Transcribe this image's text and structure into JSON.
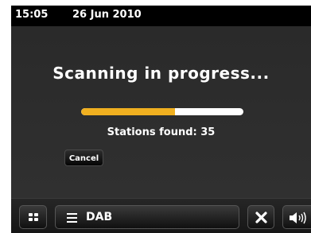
{
  "status_bar": {
    "time": "15:05",
    "date": "26 Jun 2010"
  },
  "scan": {
    "title": "Scanning in progress...",
    "progress_percent": 58,
    "stations_found": "Stations found: 35",
    "cancel_label": "Cancel"
  },
  "bottom_bar": {
    "menu_icon": "grid-icon",
    "source_icon": "hamburger-icon",
    "source_label": "DAB",
    "close_icon": "close-icon",
    "volume_icon": "volume-icon"
  },
  "colors": {
    "progress_fill": "#f0b020",
    "progress_track": "#ffffff",
    "background": "#2c2c2c",
    "status_bar": "#000000"
  }
}
